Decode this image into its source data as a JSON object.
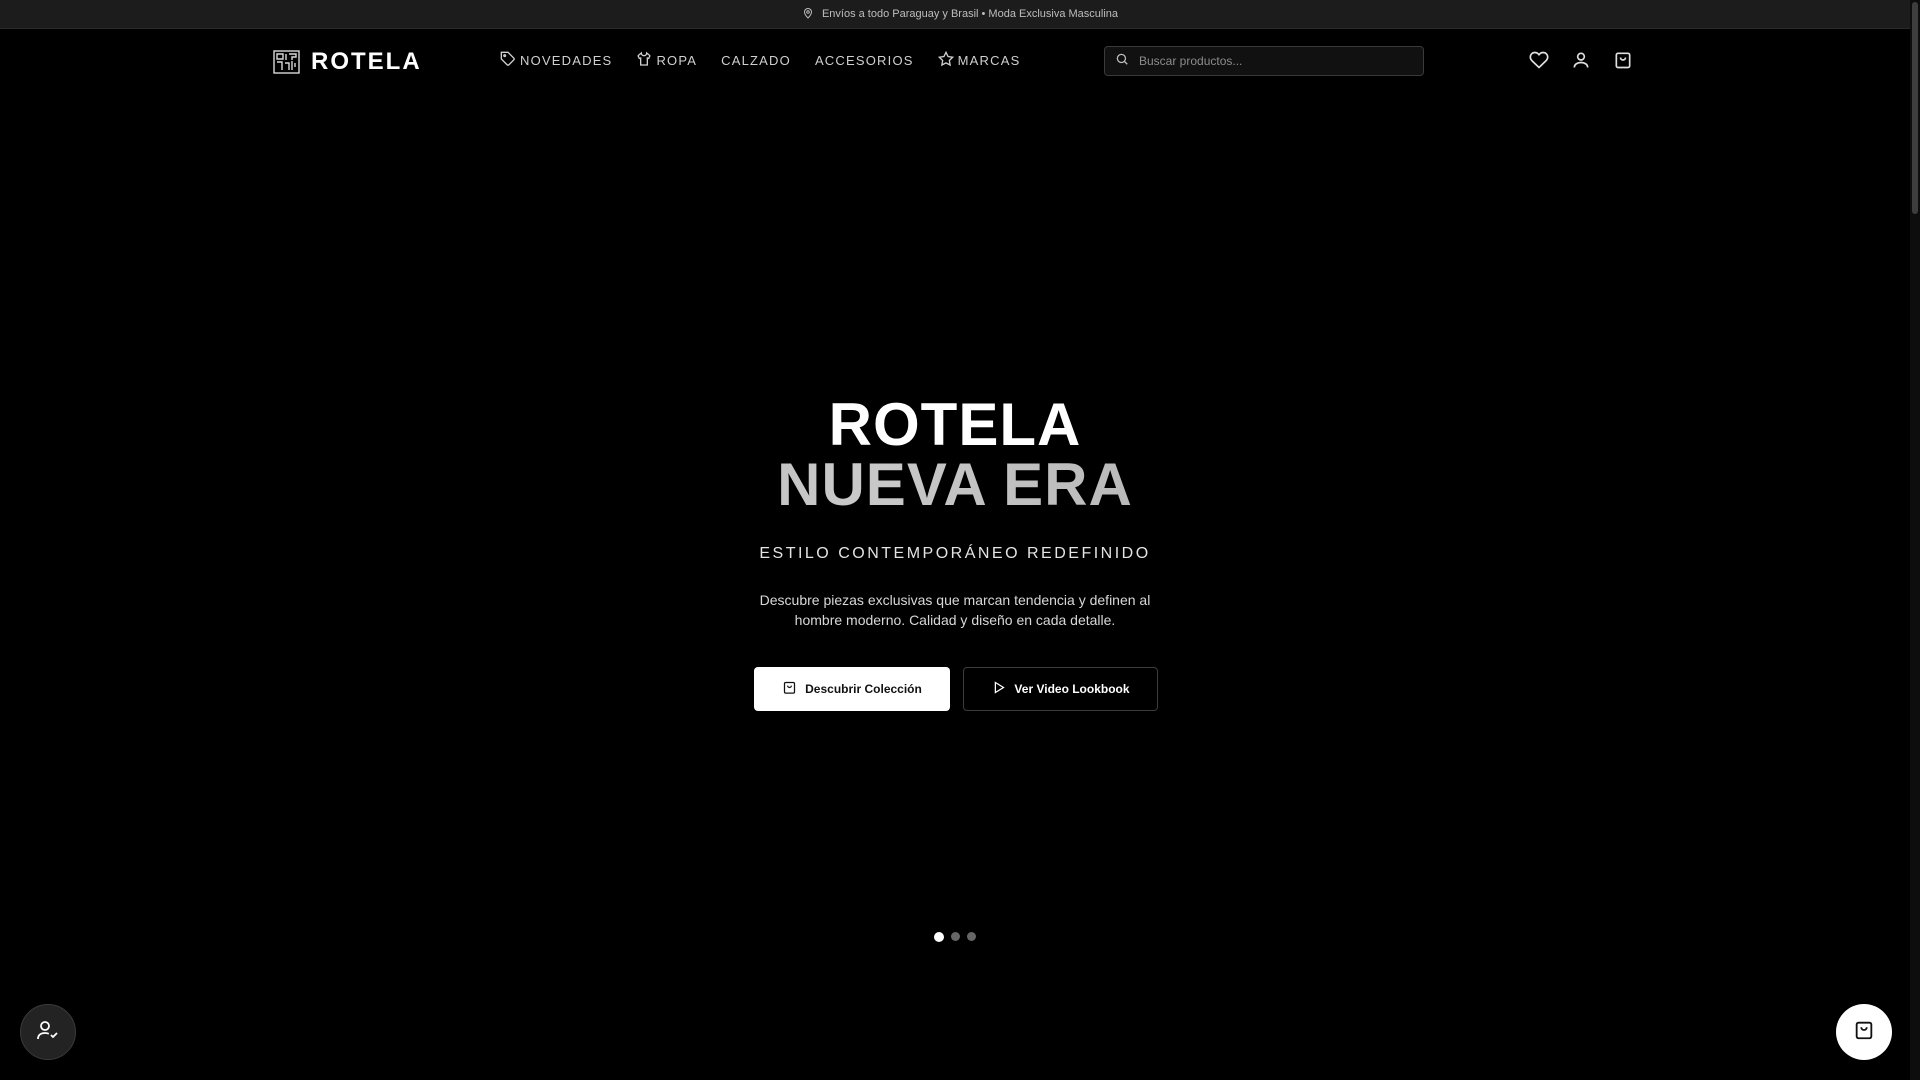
{
  "topbar": {
    "icon": "map-pin-icon",
    "text": "Envíos a todo Paraguay y Brasil • Moda Exclusiva Masculina"
  },
  "header": {
    "logo_text": "ROTELA",
    "nav": [
      {
        "label": "NOVEDADES",
        "icon": "tag-icon"
      },
      {
        "label": "ROPA",
        "icon": "shirt-icon"
      },
      {
        "label": "CALZADO",
        "icon": ""
      },
      {
        "label": "ACCESORIOS",
        "icon": ""
      },
      {
        "label": "MARCAS",
        "icon": "star-icon"
      }
    ],
    "search": {
      "placeholder": "Buscar productos...",
      "value": ""
    },
    "icons": [
      "heart-icon",
      "user-icon",
      "shopping-bag-icon"
    ]
  },
  "hero": {
    "title_line1": "ROTELA",
    "title_line2": "NUEVA ERA",
    "tagline": "ESTILO CONTEMPORÁNEO REDEFINIDO",
    "description": "Descubre piezas exclusivas que marcan tendencia y definen al hombre moderno. Calidad y diseño en cada detalle.",
    "primary_button": "Descubrir Colección",
    "secondary_button": "Ver Video Lookbook",
    "slides_total": 3,
    "active_slide": 1
  },
  "floating": {
    "left_icon": "user-check-icon",
    "right_icon": "shopping-bag-icon"
  },
  "colors": {
    "background": "#000000",
    "topbar": "#1c1c1c",
    "accent": "#ffffff"
  }
}
